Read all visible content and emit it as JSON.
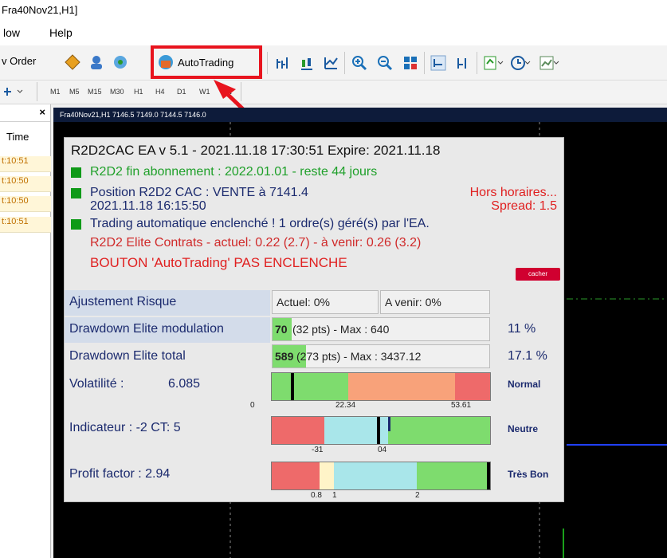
{
  "window": {
    "title": "Fra40Nov21,H1]"
  },
  "menu": {
    "items": [
      "low",
      "Help"
    ]
  },
  "toolbar": {
    "new_order": "v Order",
    "autotrading": "AutoTrading"
  },
  "periods": [
    "M1",
    "M5",
    "M15",
    "M30",
    "H1",
    "H4",
    "D1",
    "W1",
    "MN"
  ],
  "left_panel": {
    "header": "Time",
    "close": "×",
    "rows": [
      "t:10:51",
      "t:10:50",
      "t:10:50",
      "t:10:51"
    ]
  },
  "chart": {
    "caption": "Fra40Nov21,H1  7146.5 7149.0 7144.5 7146.0"
  },
  "ea": {
    "header": "R2D2CAC EA v 5.1  -  2021.11.18 17:30:51  Expire: 2021.11.18",
    "subscription": "R2D2 fin abonnement : 2022.01.01 - reste 44 jours",
    "position": "Position R2D2 CAC : VENTE à 7141.4",
    "position_time": "2021.11.18 16:15:50",
    "hors_horaires": "Hors horaires...",
    "spread": "Spread: 1.5",
    "trading": "Trading automatique enclenché ! 1 ordre(s) géré(s) par l'EA.",
    "contrats": "R2D2 Elite Contrats - actuel: 0.22 (2.7)  - à venir: 0.26 (3.2)",
    "bouton": "BOUTON 'AutoTrading' PAS ENCLENCHE",
    "cacher": "cacher",
    "ajustement_label": "Ajustement Risque",
    "actuel": "Actuel: 0%",
    "a_venir": "A venir: 0%",
    "dd_mod_label": "Drawdown Elite modulation",
    "dd_mod_value": "70",
    "dd_mod_rest": "(32 pts) - Max : 640",
    "dd_mod_pct": "11 %",
    "dd_tot_label": "Drawdown Elite total",
    "dd_tot_value": "589",
    "dd_tot_rest": "(273 pts) - Max : 3437.12",
    "dd_tot_pct": "17.1 %",
    "volatilite_label": "Volatilité :",
    "volatilite_value": "6.085",
    "vol_ticks": [
      "0",
      "22.34",
      "53.61"
    ],
    "vol_state": "Normal",
    "indicateur_label": "Indicateur : -2   CT: 5",
    "ind_ticks": [
      "-31",
      "04"
    ],
    "ind_state": "Neutre",
    "profit_label": "Profit factor :  2.94",
    "pf_ticks": [
      "0.8",
      "1",
      "2"
    ],
    "pf_state": "Très Bon"
  },
  "colors": {
    "green": "#0f9a18",
    "red": "#e8141e",
    "navy": "#1b2a6e",
    "bar_green": "#7edc6e",
    "bar_red": "#ee6a6a",
    "bar_cyan": "#a9e6ea",
    "bar_orange": "#f8a27a"
  }
}
